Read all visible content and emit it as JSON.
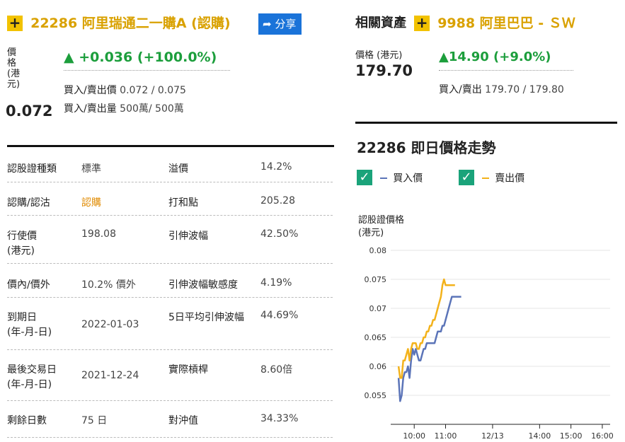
{
  "warrant": {
    "title": "22286 阿里瑞通二一購A (認購)",
    "share_label": "分享",
    "price_label_lines": [
      "價",
      "格",
      "(港",
      "元)"
    ],
    "price": "0.072",
    "change": "▲ +0.036 (+100.0%)",
    "bidask_price_label": "買入/賣出價",
    "bidask_price": "0.072 / 0.075",
    "bidask_vol_label": "買入/賣出量",
    "bidask_vol": "500萬/ 500萬"
  },
  "related": {
    "label": "相關資產",
    "title": "9988 阿里巴巴 - ＳＷ",
    "price_label": "價格 (港元)",
    "price": "179.70",
    "change": "▲14.90 (+9.0%)",
    "bidask_label": "買入/賣出",
    "bidask": "179.70 / 179.80"
  },
  "table": {
    "rows": [
      {
        "l1": "認股證種類",
        "l1b": "",
        "v1": "標準",
        "l2": "溢價",
        "v2": "14.2%"
      },
      {
        "l1": "認購/認沽",
        "l1b": "",
        "v1": "認購",
        "l2": "打和點",
        "v2": "205.28"
      },
      {
        "l1": "行使價",
        "l1b": "(港元)",
        "v1": "198.08",
        "l2": "引伸波幅",
        "v2": "42.50%"
      },
      {
        "l1": "價內/價外",
        "l1b": "",
        "v1": "10.2% 價外",
        "l2": "引伸波幅敏感度",
        "v2": "4.19%"
      },
      {
        "l1": "到期日",
        "l1b": "(年-月-日)",
        "v1": "2022-01-03",
        "l2": "5日平均引伸波幅",
        "v2": "44.69%"
      },
      {
        "l1": "最後交易日",
        "l1b": "(年-月-日)",
        "v1": "2021-12-24",
        "l2": "實際槓桿",
        "v2": "8.60倍"
      },
      {
        "l1": "剩餘日數",
        "l1b": "",
        "v1": "75 日",
        "l2": "對沖值",
        "v2": "34.33%"
      }
    ]
  },
  "chart_panel": {
    "title": "22286 即日價格走勢",
    "legend_bid": "買入價",
    "legend_ask": "賣出價",
    "checkmark": "✓",
    "ylabel_line1": "認股證價格",
    "ylabel_line2": "(港元)"
  },
  "chart_data": {
    "type": "line",
    "ylabel": "認股證價格 (港元)",
    "ylim": [
      0.05,
      0.08
    ],
    "yticks": [
      "0.08",
      "0.075",
      "0.07",
      "0.065",
      "0.06",
      "0.055"
    ],
    "xticks": [
      "10:00",
      "11:00",
      "12/13",
      "14:00",
      "15:00",
      "16:00"
    ],
    "series": [
      {
        "name": "買入價",
        "color": "#5b74b8",
        "x": [
          9.5,
          9.55,
          9.6,
          9.65,
          9.7,
          9.75,
          9.8,
          9.85,
          9.9,
          9.95,
          10.0,
          10.05,
          10.1,
          10.15,
          10.2,
          10.25,
          10.3,
          10.35,
          10.4,
          10.45,
          10.5,
          10.55,
          10.6,
          10.65,
          10.7,
          10.75,
          10.8,
          10.85,
          10.9,
          10.95,
          11.0,
          11.05,
          11.1,
          11.15,
          11.2,
          11.25,
          11.3,
          11.35,
          11.4,
          11.45,
          11.5
        ],
        "values": [
          0.058,
          0.054,
          0.055,
          0.058,
          0.059,
          0.059,
          0.06,
          0.058,
          0.061,
          0.063,
          0.062,
          0.063,
          0.062,
          0.061,
          0.061,
          0.062,
          0.063,
          0.063,
          0.064,
          0.064,
          0.064,
          0.064,
          0.064,
          0.064,
          0.065,
          0.066,
          0.066,
          0.066,
          0.067,
          0.067,
          0.068,
          0.069,
          0.07,
          0.071,
          0.072,
          0.072,
          0.072,
          0.072,
          0.072,
          0.072,
          0.072
        ]
      },
      {
        "name": "賣出價",
        "color": "#f3b21b",
        "x": [
          9.5,
          9.55,
          9.6,
          9.65,
          9.7,
          9.75,
          9.8,
          9.85,
          9.9,
          9.95,
          10.0,
          10.05,
          10.1,
          10.15,
          10.2,
          10.25,
          10.3,
          10.35,
          10.4,
          10.45,
          10.5,
          10.55,
          10.6,
          10.65,
          10.7,
          10.75,
          10.8,
          10.85,
          10.9,
          10.95,
          11.0,
          11.05,
          11.1,
          11.15,
          11.2,
          11.25,
          11.3
        ],
        "values": [
          0.06,
          0.058,
          0.058,
          0.061,
          0.061,
          0.062,
          0.063,
          0.061,
          0.063,
          0.064,
          0.064,
          0.064,
          0.063,
          0.063,
          0.064,
          0.064,
          0.065,
          0.065,
          0.066,
          0.066,
          0.067,
          0.067,
          0.068,
          0.068,
          0.069,
          0.07,
          0.071,
          0.072,
          0.074,
          0.075,
          0.074,
          0.074,
          0.074,
          0.074,
          0.074,
          0.074,
          0.074
        ]
      }
    ]
  },
  "colors": {
    "accent": "#f2c200",
    "gold_text": "#d9a100",
    "up_green": "#1c9e3c",
    "share_blue": "#1a73d9",
    "check_green": "#1aa37a"
  }
}
